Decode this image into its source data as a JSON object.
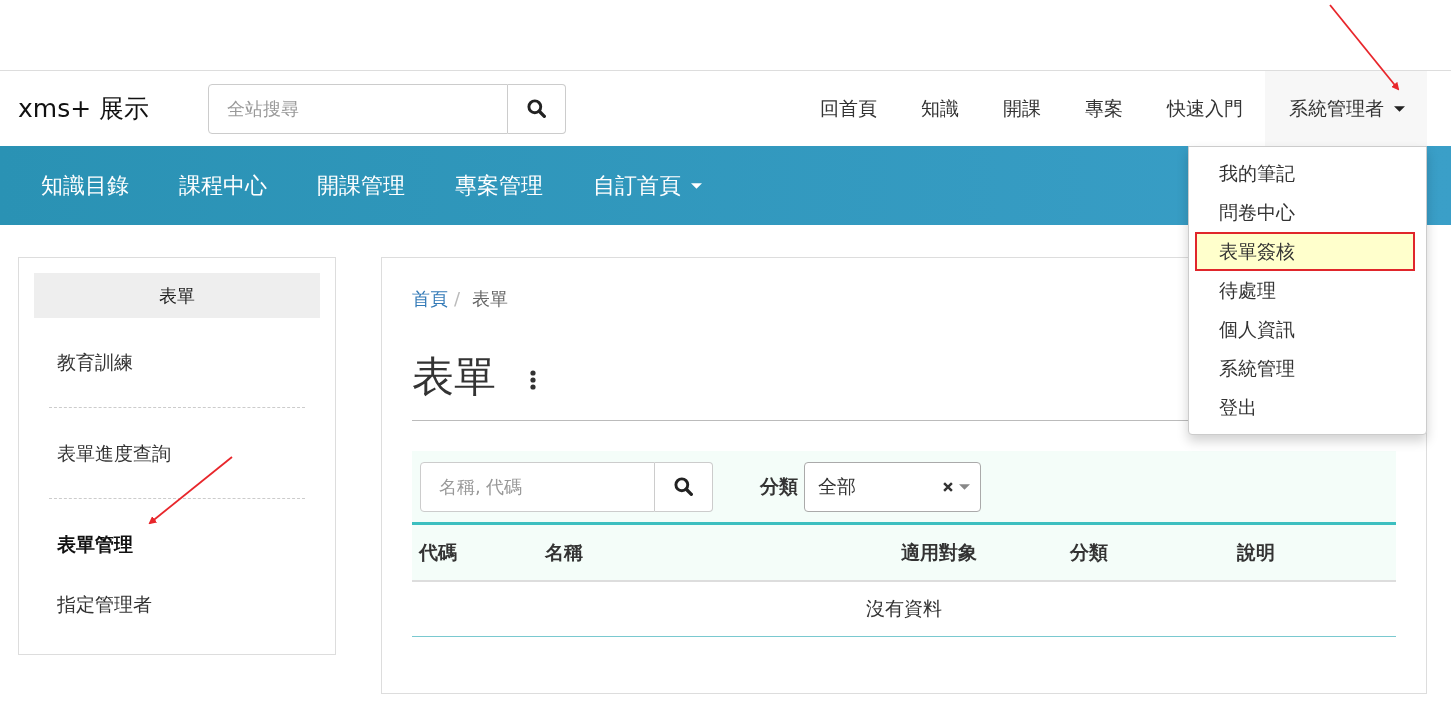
{
  "site": {
    "logo": "xms+ 展示",
    "search": {
      "placeholder": "全站搜尋"
    }
  },
  "top_nav": [
    {
      "label": "回首頁",
      "kind": "link"
    },
    {
      "label": "知識",
      "kind": "link"
    },
    {
      "label": "開課",
      "kind": "link"
    },
    {
      "label": "專案",
      "kind": "link"
    },
    {
      "label": "快速入門",
      "kind": "link"
    },
    {
      "label": "系統管理者",
      "kind": "dropdown",
      "expanded": true
    }
  ],
  "user_menu": [
    {
      "label": "我的筆記",
      "highlighted": false
    },
    {
      "label": "問卷中心",
      "highlighted": false
    },
    {
      "label": "表單簽核",
      "highlighted": true
    },
    {
      "label": "待處理",
      "highlighted": false
    },
    {
      "label": "個人資訊",
      "highlighted": false
    },
    {
      "label": "系統管理",
      "highlighted": false
    },
    {
      "label": "登出",
      "highlighted": false
    }
  ],
  "main_nav": [
    {
      "label": "知識目錄",
      "kind": "link"
    },
    {
      "label": "課程中心",
      "kind": "link"
    },
    {
      "label": "開課管理",
      "kind": "link"
    },
    {
      "label": "專案管理",
      "kind": "link"
    },
    {
      "label": "自訂首頁",
      "kind": "dropdown"
    }
  ],
  "sidebar": {
    "title": "表單",
    "items": [
      {
        "label": "教育訓練",
        "selected": false
      },
      {
        "label": "表單進度查詢",
        "selected": false
      },
      {
        "label": "表單管理",
        "selected": true
      },
      {
        "label": "指定管理者",
        "selected": false
      }
    ]
  },
  "breadcrumb": {
    "separator": "/",
    "items": [
      {
        "label": "首頁",
        "kind": "link"
      },
      {
        "label": "表單",
        "kind": "current"
      }
    ]
  },
  "page_title": "表單",
  "filter": {
    "search": {
      "placeholder": "名稱, 代碼"
    },
    "category": {
      "label": "分類",
      "value": "全部"
    }
  },
  "table": {
    "columns": [
      "代碼",
      "名稱",
      "適用對象",
      "分類",
      "說明"
    ],
    "empty_text": "沒有資料"
  }
}
